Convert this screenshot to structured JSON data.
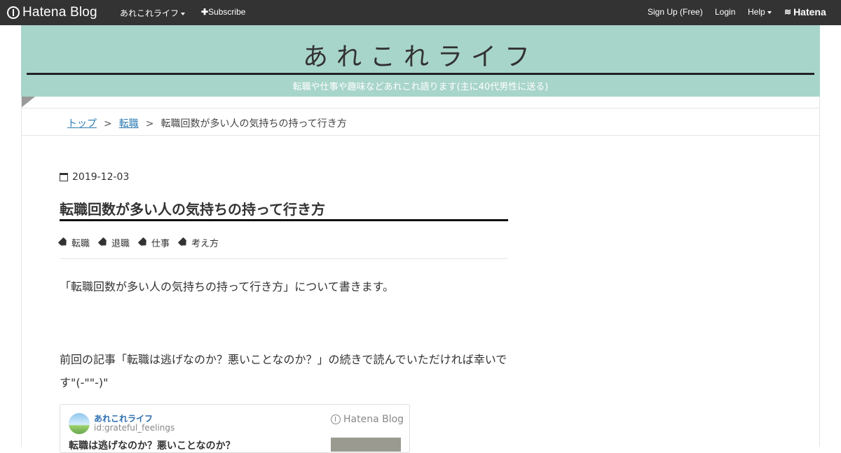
{
  "topbar": {
    "logo": "Hatena Blog",
    "blog_menu": "あれこれライフ",
    "subscribe": "Subscribe",
    "signup": "Sign Up (Free)",
    "login": "Login",
    "help": "Help",
    "hatena": "Hatena"
  },
  "header": {
    "title": "あれこれライフ",
    "description": "転職や仕事や趣味などあれこれ語ります(主に40代男性に送る)"
  },
  "breadcrumb": {
    "items": [
      "トップ",
      "転職"
    ],
    "current": "転職回数が多い人の気持ちの持って行き方",
    "separator": ">"
  },
  "article": {
    "date": "2019-12-03",
    "title": "転職回数が多い人の気持ちの持って行き方",
    "tags": [
      "転職",
      "退職",
      "仕事",
      "考え方"
    ],
    "paragraph1": "「転職回数が多い人の気持ちの持って行き方」について書きます。",
    "paragraph2": "前回の記事「転職は逃げなのか？悪いことなのか？」の続きで読んでいただければ幸いです\"(-\"\"-)\""
  },
  "embed": {
    "blog_name": "あれこれライフ",
    "blog_id": "id:grateful_feelings",
    "brand": "Hatena Blog",
    "title": "転職は逃げなのか？悪いことなのか？"
  },
  "colors": {
    "topbar_bg": "#333333",
    "header_bg": "#a8d5c9",
    "link": "#2c7cb5"
  }
}
